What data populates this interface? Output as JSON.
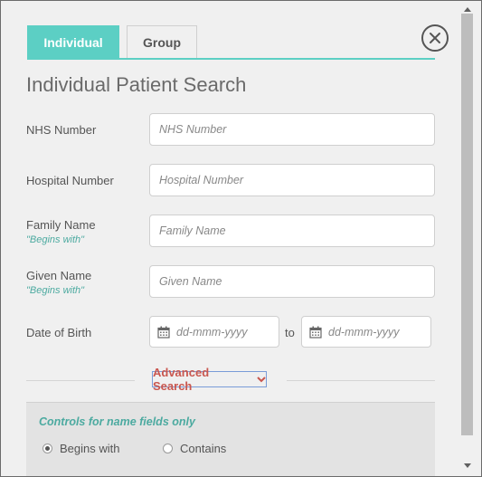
{
  "tabs": {
    "individual": "Individual",
    "group": "Group"
  },
  "title": "Individual Patient Search",
  "fields": {
    "nhs": {
      "label": "NHS Number",
      "placeholder": "NHS Number"
    },
    "hospital": {
      "label": "Hospital Number",
      "placeholder": "Hospital Number"
    },
    "family": {
      "label": "Family Name",
      "hint": "\"Begins with\"",
      "placeholder": "Family Name"
    },
    "given": {
      "label": "Given Name",
      "hint": "\"Begins with\"",
      "placeholder": "Given Name"
    },
    "dob": {
      "label": "Date of Birth",
      "from_placeholder": "dd-mmm-yyyy",
      "to_label": "to",
      "to_placeholder": "dd-mmm-yyyy"
    }
  },
  "advanced_search": "Advanced Search",
  "controls": {
    "title": "Controls for name fields only",
    "options": [
      "Begins with",
      "Contains"
    ],
    "selected": "Begins with"
  },
  "icons": {
    "close": "close-icon",
    "calendar": "calendar-icon",
    "chevron": "chevron-down-icon"
  },
  "colors": {
    "accent": "#5ccfc4",
    "hint": "#4caaa0",
    "advanced": "#c9574f"
  }
}
